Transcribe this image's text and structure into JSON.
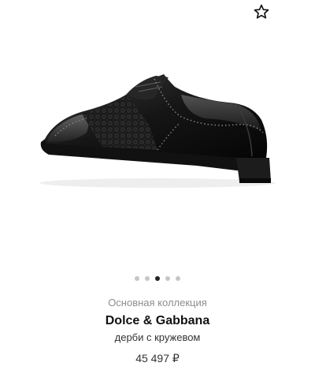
{
  "header": {
    "favorite_icon": "star-outline-icon"
  },
  "gallery": {
    "image_subject": "shoe-image",
    "dots_count": 5,
    "active_index": 3
  },
  "product": {
    "collection": "Основная коллекция",
    "brand": "Dolce & Gabbana",
    "description": "дерби с кружевом",
    "price": "45 497 ₽"
  },
  "colors": {
    "dot_inactive": "#c6c6c6",
    "dot_active": "#222222",
    "muted_text": "#8e8e8e"
  }
}
